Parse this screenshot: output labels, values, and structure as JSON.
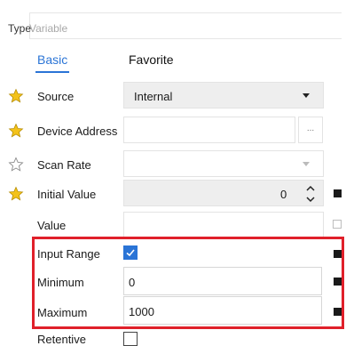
{
  "type_row": {
    "label": "Type",
    "value": "Variable"
  },
  "tabs": [
    {
      "label": "Basic",
      "active": true
    },
    {
      "label": "Favorite",
      "active": false
    }
  ],
  "rows": {
    "source": {
      "label": "Source",
      "value": "Internal",
      "favorite": true
    },
    "device_address": {
      "label": "Device Address",
      "value": "",
      "button": "...",
      "favorite": true
    },
    "scan_rate": {
      "label": "Scan Rate",
      "value": "",
      "favorite": false
    },
    "initial_value": {
      "label": "Initial Value",
      "value": "0",
      "favorite": true
    },
    "value": {
      "label": "Value",
      "value": ""
    },
    "input_range": {
      "label": "Input Range",
      "checked": true
    },
    "minimum": {
      "label": "Minimum",
      "value": "0"
    },
    "maximum": {
      "label": "Maximum",
      "value": "1000"
    },
    "retentive": {
      "label": "Retentive",
      "checked": false
    }
  },
  "colors": {
    "accent": "#2a74d6",
    "star": "#f3c21a",
    "highlight": "#e0202a"
  }
}
